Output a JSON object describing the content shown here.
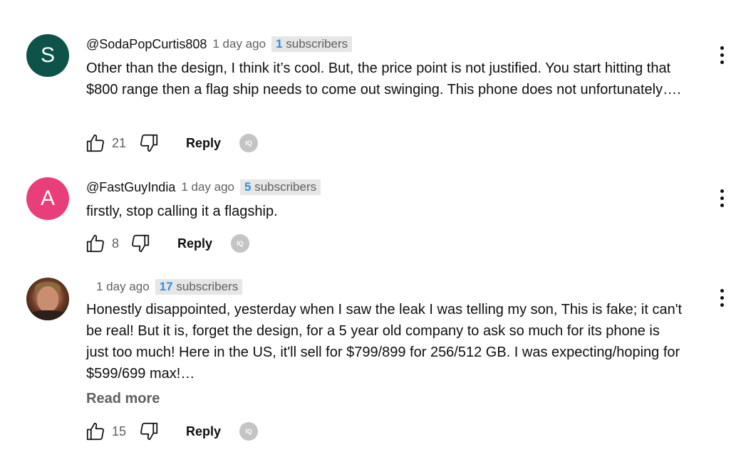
{
  "comments": [
    {
      "avatar_letter": "S",
      "avatar_color": "#0d5347",
      "author": "@SodaPopCurtis808",
      "time": "1 day ago",
      "subscriber_count": "1",
      "subscriber_label": " subscribers",
      "text": "Other than the design, I think it’s cool. But, the price point is not justified. You start hitting that $800 range then a flag ship needs to come out swinging. This phone does not unfortunately….",
      "likes": "21",
      "reply_label": "Reply"
    },
    {
      "avatar_letter": "A",
      "avatar_color": "#e83f7b",
      "author": "@FastGuyIndia",
      "time": "1 day ago",
      "subscriber_count": "5",
      "subscriber_label": " subscribers",
      "text": "firstly, stop calling it a flagship.",
      "likes": "8",
      "reply_label": "Reply"
    },
    {
      "avatar_type": "photo",
      "author": "",
      "time": "1 day ago",
      "subscriber_count": "17",
      "subscriber_label": " subscribers",
      "text": "Honestly disappointed, yesterday when I saw the leak I was telling my son, This is fake; it can't be real! But it is, forget the design, for a 5 year old company to ask so much for its phone is just too much! Here in the US, it'll sell for $799/899 for 256/512 GB. I was expecting/hoping for $599/699 max!…",
      "read_more": "Read more",
      "likes": "15",
      "reply_label": "Reply"
    }
  ],
  "icons": {
    "like": "thumb-up-icon",
    "dislike": "thumb-down-icon",
    "badge": "iq-badge-icon",
    "menu": "more-vert-icon"
  },
  "badge_text": "IQ",
  "colors": {
    "subscriber_count": "#2d8fe6",
    "secondary_text": "#606060",
    "badge_bg": "#e6e6e6"
  }
}
